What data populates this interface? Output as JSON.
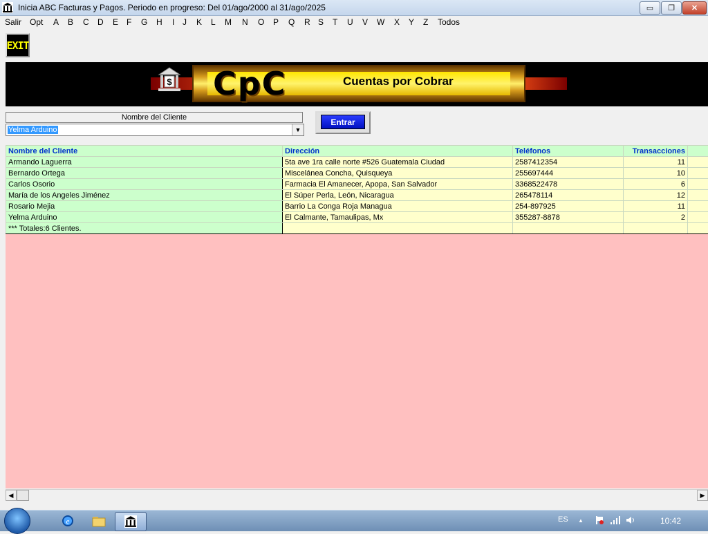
{
  "window": {
    "title": "Inicia ABC Facturas y Pagos. Periodo en progreso: Del 01/ago/2000 al 31/ago/2025",
    "buttons": {
      "minimize": "▭",
      "restore": "❐",
      "close": "✕"
    }
  },
  "menu": {
    "items": [
      "Salir",
      "Opt",
      "A",
      "B",
      "C",
      "D",
      "E",
      "F",
      "G",
      "H",
      "I",
      "J",
      "K",
      "L",
      "M",
      "N",
      "O",
      "P",
      "Q",
      "R",
      "S",
      "T",
      "U",
      "V",
      "W",
      "X",
      "Y",
      "Z",
      "Todos"
    ]
  },
  "toolbar": {
    "exit_label": "EXIT"
  },
  "banner": {
    "logo": "CpC",
    "subtitle": "Cuentas por Cobrar"
  },
  "search": {
    "label": "Nombre del Cliente",
    "selected": "Yelma Arduino",
    "button_label": "Entrar"
  },
  "table": {
    "headers": [
      "Nombre del Cliente",
      "Dirección",
      "Teléfonos",
      "Transacciones"
    ],
    "rows": [
      [
        "Armando Laguerra",
        "5ta ave 1ra calle norte #526 Guatemala Ciudad",
        "2587412354",
        "11"
      ],
      [
        "Bernardo Ortega",
        "Miscelánea Concha, Quisqueya",
        "255697444",
        "10"
      ],
      [
        "Carlos Osorio",
        "Farmacia El Amanecer, Apopa, San Salvador",
        "3368522478",
        "6"
      ],
      [
        "María de los Angeles Jiménez",
        "El Súper Perla, León, Nicaragua",
        "265478114",
        "12"
      ],
      [
        "Rosario Mejia",
        "Barrio La Conga Roja Managua",
        "254-897925",
        "11"
      ],
      [
        "Yelma Arduino",
        "El Calmante, Tamaulipas, Mx",
        "355287-8878",
        "2"
      ]
    ],
    "totals": "*** Totales:6 Clientes."
  },
  "scroll": {
    "left": "◀",
    "right": "▶"
  },
  "taskbar": {
    "language": "ES",
    "clock": "10:42",
    "tray_up": "▲"
  },
  "colors": {
    "header_bg": "#ccffcc",
    "header_text": "#0033cc",
    "cell_bg": "#ffffcc",
    "empty_area": "#ffc0c0"
  }
}
